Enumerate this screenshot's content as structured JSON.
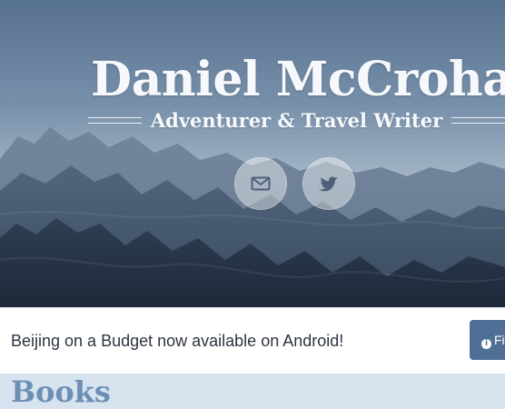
{
  "header": {
    "title": "Daniel McCrohan",
    "subtitle": "Adventurer & Travel Writer"
  },
  "social": [
    {
      "label": "email",
      "icon": "envelope-icon"
    },
    {
      "label": "twitter",
      "icon": "twitter-icon"
    }
  ],
  "announcement": {
    "text": "Beijing on a Budget now available on Android!",
    "button_label": "Fi",
    "button_icon": "info-icon",
    "button_color": "#4f6f97"
  },
  "books": {
    "title": "Books"
  },
  "colors": {
    "hero_tint": "#6f88a6",
    "section_bg": "#d7e4f0",
    "heading_blue": "#6e8fb4"
  }
}
